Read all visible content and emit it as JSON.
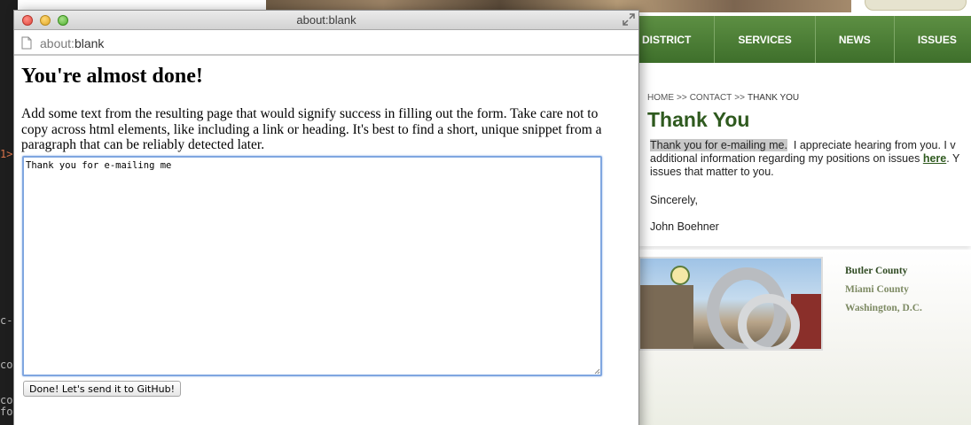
{
  "editor_fragments": [
    "1>",
    "c-c",
    "co",
    "co",
    "for"
  ],
  "site": {
    "nav": [
      "DISTRICT",
      "SERVICES",
      "NEWS",
      "ISSUES"
    ],
    "breadcrumb": {
      "home": "HOME",
      "contact": "CONTACT",
      "current": "THANK YOU",
      "separator": ">>"
    },
    "title": "Thank You",
    "body": {
      "highlight": "Thank you for e-mailing me.",
      "line1_rest": "I appreciate hearing from you.  I v",
      "line2_a": "additional information regarding my positions on issues",
      "link": "here",
      "line2_b": ".  Y",
      "line3": "issues that matter to you."
    },
    "closing": "Sincerely,",
    "signature": "John Boehner",
    "counties": [
      "Butler County",
      "Miami County",
      "Washington, D.C."
    ],
    "colors": {
      "nav_green": "#4a7d33",
      "title_green": "#2f5a1f",
      "link_green": "#2f5a1f"
    }
  },
  "popup": {
    "window_title": "about:blank",
    "url": {
      "scheme": "about:",
      "rest": "blank"
    },
    "heading": "You're almost done!",
    "instructions": "Add some text from the resulting page that would signify success in filling out the form. Take care not to copy across html elements, like including a link or heading. It's best to find a short, unique snippet from a paragraph that can be reliably detected later.",
    "textarea_value": "Thank you for e-mailing me",
    "submit_label": "Done! Let's send it to GitHub!",
    "icons": [
      "close-button",
      "minimize-button",
      "zoom-button",
      "fullscreen-icon",
      "page-icon"
    ],
    "colors": {
      "focus_ring": "#7fa6e0",
      "close": "#e0463c",
      "minimize": "#e0a628",
      "zoom": "#4fb02e"
    }
  }
}
